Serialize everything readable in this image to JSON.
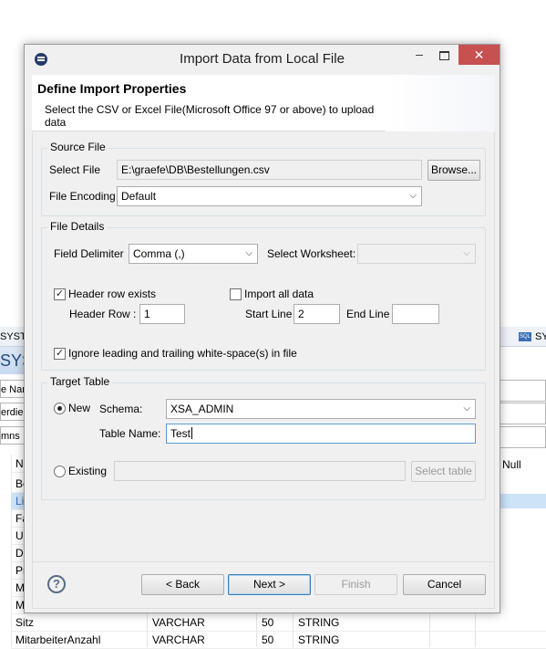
{
  "background": {
    "left_tab": "SYSTE",
    "left_title": "SYST",
    "left_fields": [
      "e Nam",
      "erdien",
      "mns"
    ],
    "left_rows": [
      "N",
      "Be",
      "Li",
      "Fa",
      "U",
      "D",
      "Pr",
      "M",
      "M"
    ],
    "right_tab": "SY",
    "right_tab_icon": "sql-icon",
    "right_col_header": "Null",
    "bottom_rows": [
      {
        "name": "Sitz",
        "type": "VARCHAR",
        "len": "50",
        "sql": "STRING"
      },
      {
        "name": "MitarbeiterAnzahl",
        "type": "VARCHAR",
        "len": "50",
        "sql": "STRING"
      }
    ]
  },
  "dialog": {
    "title": "Import Data from Local File",
    "win_min": "–",
    "win_close": "✕",
    "header_title": "Define Import Properties",
    "header_desc": "Select the CSV or Excel File(Microsoft Office 97 or above) to upload data",
    "source": {
      "group": "Source File",
      "select_file_label": "Select File",
      "select_file_value": "E:\\graefe\\DB\\Bestellungen.csv",
      "browse": "Browse...",
      "encoding_label": "File Encoding",
      "encoding_value": "Default"
    },
    "details": {
      "group": "File Details",
      "delimiter_label": "Field Delimiter",
      "delimiter_value": "Comma (,)",
      "worksheet_label": "Select Worksheet:",
      "worksheet_value": "",
      "header_row_exists_label": "Header row exists",
      "header_row_exists_checked": true,
      "import_all_label": "Import all data",
      "import_all_checked": false,
      "header_row_label": "Header Row :",
      "header_row_value": "1",
      "start_line_label": "Start Line",
      "start_line_value": "2",
      "end_line_label": "End Line",
      "end_line_value": "",
      "ignore_ws_label": "Ignore leading and trailing white-space(s) in file",
      "ignore_ws_checked": true
    },
    "target": {
      "group": "Target Table",
      "new_label": "New",
      "schema_label": "Schema:",
      "schema_value": "XSA_ADMIN",
      "table_name_label": "Table Name:",
      "table_name_value": "Test",
      "existing_label": "Existing",
      "existing_value": "",
      "select_table": "Select table"
    },
    "footer": {
      "help": "?",
      "back": "< Back",
      "next": "Next >",
      "finish": "Finish",
      "cancel": "Cancel"
    }
  },
  "colors": {
    "close_button": "#c75050",
    "selection": "#cde3f8",
    "group_border": "#d5dfe5"
  }
}
